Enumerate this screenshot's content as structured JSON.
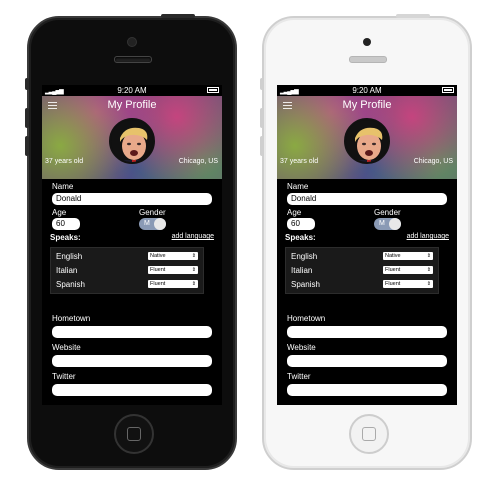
{
  "status": {
    "time": "9:20 AM",
    "signal": "▂▃▄▅▆"
  },
  "profile": {
    "title": "My Profile",
    "age_text": "37 years old",
    "location": "Chicago, US"
  },
  "form": {
    "name_label": "Name",
    "name_value": "Donald",
    "age_label": "Age",
    "age_value": "60",
    "gender_label": "Gender",
    "gender_value": "M",
    "speaks_label": "Speaks:",
    "add_language": "add language",
    "languages": [
      {
        "name": "English",
        "level": "Native"
      },
      {
        "name": "Italian",
        "level": "Fluent"
      },
      {
        "name": "Spanish",
        "level": "Fluent"
      }
    ],
    "hometown_label": "Hometown",
    "website_label": "Website",
    "twitter_label": "Twitter"
  },
  "icons": {
    "menu": "menu-icon",
    "home": "home-button-icon",
    "dropdown": "chevron-updown-icon",
    "battery": "battery-icon"
  },
  "colors": {
    "phone_black": "#0d0d0d",
    "phone_white": "#f7f7f7",
    "toggle": "#8a9ab5"
  }
}
